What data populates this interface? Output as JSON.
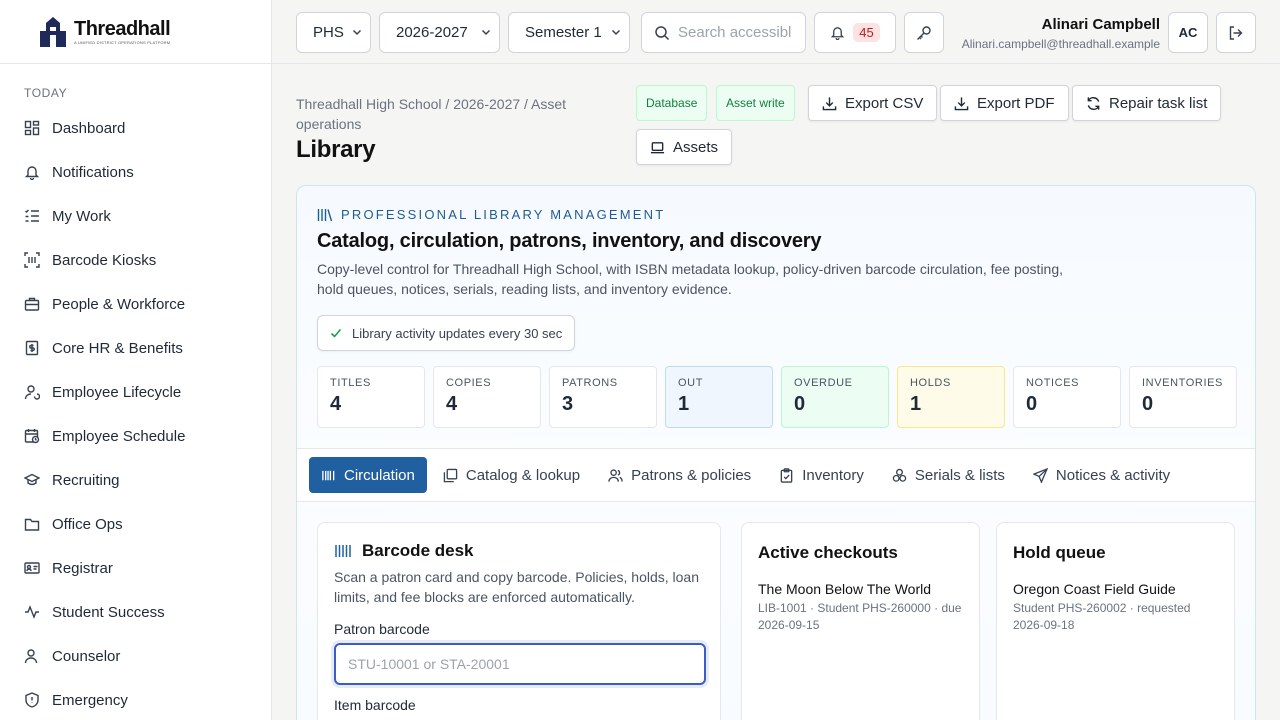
{
  "app": {
    "logo_title": "Threadhall",
    "logo_sub": "A UNIFIED DISTRICT OPERATIONS PLATFORM"
  },
  "sidebar": {
    "section": "TODAY",
    "items": [
      {
        "label": "Dashboard",
        "icon": "dashboard-icon"
      },
      {
        "label": "Notifications",
        "icon": "bell-icon"
      },
      {
        "label": "My Work",
        "icon": "list-check-icon"
      },
      {
        "label": "Barcode Kiosks",
        "icon": "barcode-scan-icon"
      },
      {
        "label": "People & Workforce",
        "icon": "briefcase-icon"
      },
      {
        "label": "Core HR & Benefits",
        "icon": "dollar-doc-icon"
      },
      {
        "label": "Employee Lifecycle",
        "icon": "user-cycle-icon"
      },
      {
        "label": "Employee Schedule",
        "icon": "calendar-clock-icon"
      },
      {
        "label": "Recruiting",
        "icon": "graduation-cap-icon"
      },
      {
        "label": "Office Ops",
        "icon": "folder-icon"
      },
      {
        "label": "Registrar",
        "icon": "id-card-icon"
      },
      {
        "label": "Student Success",
        "icon": "activity-icon"
      },
      {
        "label": "Counselor",
        "icon": "user-icon"
      },
      {
        "label": "Emergency",
        "icon": "shield-alert-icon"
      }
    ]
  },
  "topbar": {
    "school": "PHS",
    "year": "2026-2027",
    "term": "Semester 1",
    "search_placeholder": "Search accessible",
    "notif_count": "45",
    "user_name": "Alinari Campbell",
    "user_email": "Alinari.campbell@threadhall.example",
    "initials": "AC"
  },
  "page": {
    "breadcrumb": "Threadhall High School / 2026-2027 / Asset operations",
    "title": "Library",
    "tags": [
      "Database",
      "Asset write"
    ],
    "actions": {
      "export_csv": "Export CSV",
      "export_pdf": "Export PDF",
      "repair": "Repair task list",
      "assets": "Assets"
    }
  },
  "card": {
    "eyebrow": "PROFESSIONAL LIBRARY MANAGEMENT",
    "title": "Catalog, circulation, patrons, inventory, and discovery",
    "desc": "Copy-level control for Threadhall High School, with ISBN metadata lookup, policy-driven barcode circulation, fee posting, hold queues, notices, serials, reading lists, and inventory evidence.",
    "status": "Library activity updates every 30 sec",
    "stats": [
      {
        "label": "TITLES",
        "value": "4"
      },
      {
        "label": "COPIES",
        "value": "4"
      },
      {
        "label": "PATRONS",
        "value": "3"
      },
      {
        "label": "OUT",
        "value": "1"
      },
      {
        "label": "OVERDUE",
        "value": "0"
      },
      {
        "label": "HOLDS",
        "value": "1"
      },
      {
        "label": "NOTICES",
        "value": "0"
      },
      {
        "label": "INVENTORIES",
        "value": "0"
      }
    ],
    "tabs": [
      "Circulation",
      "Catalog & lookup",
      "Patrons & policies",
      "Inventory",
      "Serials & lists",
      "Notices & activity"
    ]
  },
  "barcode_desk": {
    "title": "Barcode desk",
    "desc": "Scan a patron card and copy barcode. Policies, holds, loan limits, and fee blocks are enforced automatically.",
    "patron_label": "Patron barcode",
    "patron_placeholder": "STU-10001 or STA-20001",
    "item_label": "Item barcode"
  },
  "active_checkouts": {
    "title": "Active checkouts",
    "item_title": "The Moon Below The World",
    "item_meta": "LIB-1001 · Student PHS-260000 · due 2026-09-15"
  },
  "hold_queue": {
    "title": "Hold queue",
    "item_title": "Oregon Coast Field Guide",
    "item_meta": "Student PHS-260002 · requested 2026-09-18"
  },
  "colors": {
    "accent": "#2160a0",
    "eyebrow": "#1e5c94",
    "success": "#15803d",
    "badge": "#b91c1c",
    "focus": "#3b5cc4"
  }
}
